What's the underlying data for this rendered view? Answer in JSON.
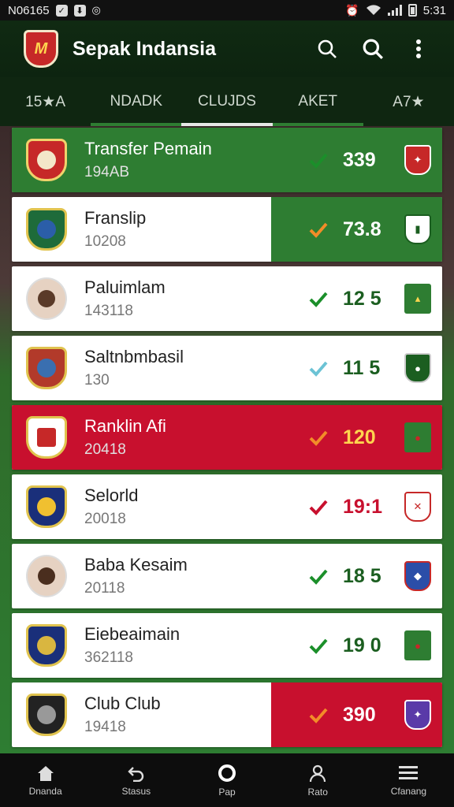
{
  "status_bar": {
    "left_text": "N06165",
    "time": "5:31"
  },
  "app_bar": {
    "title": "Sepak Indansia"
  },
  "tabs": [
    {
      "label": "15★A"
    },
    {
      "label": "NDADK"
    },
    {
      "label": "CLUJDS"
    },
    {
      "label": "AKET"
    },
    {
      "label": "A7★"
    }
  ],
  "rows": [
    {
      "name": "Transfer Pemain",
      "sub": "194AB",
      "score": "339",
      "style": "green",
      "check_color": "#1b8f2a"
    },
    {
      "name": "Franslip",
      "sub": "10208",
      "score": "73.8",
      "style": "green-right",
      "check_color": "#f28c28"
    },
    {
      "name": "Paluimlam",
      "sub": "143118",
      "score": "12 5",
      "style": "plain",
      "check_color": "#1b8f2a"
    },
    {
      "name": "Saltnbmbasil",
      "sub": "130",
      "score": "11 5",
      "style": "plain",
      "check_color": "#6cc3d5"
    },
    {
      "name": "Ranklin Afi",
      "sub": "20418",
      "score": "120",
      "style": "red",
      "check_color": "#f28c28"
    },
    {
      "name": "Selorld",
      "sub": "20018",
      "score": "19:1",
      "style": "red-score",
      "check_color": "#c8102e"
    },
    {
      "name": "Baba Kesaim",
      "sub": "20118",
      "score": "18 5",
      "style": "plain",
      "check_color": "#1b8f2a"
    },
    {
      "name": "Eiebeaimain",
      "sub": "362118",
      "score": "19 0",
      "style": "plain",
      "check_color": "#1b8f2a"
    },
    {
      "name": "Club Club",
      "sub": "19418",
      "score": "390",
      "style": "red-right",
      "check_color": "#f28c28"
    }
  ],
  "bottom_nav": [
    {
      "label": "Dnanda"
    },
    {
      "label": "Stasus"
    },
    {
      "label": "Pap"
    },
    {
      "label": "Rato"
    },
    {
      "label": "Cfanang"
    }
  ]
}
